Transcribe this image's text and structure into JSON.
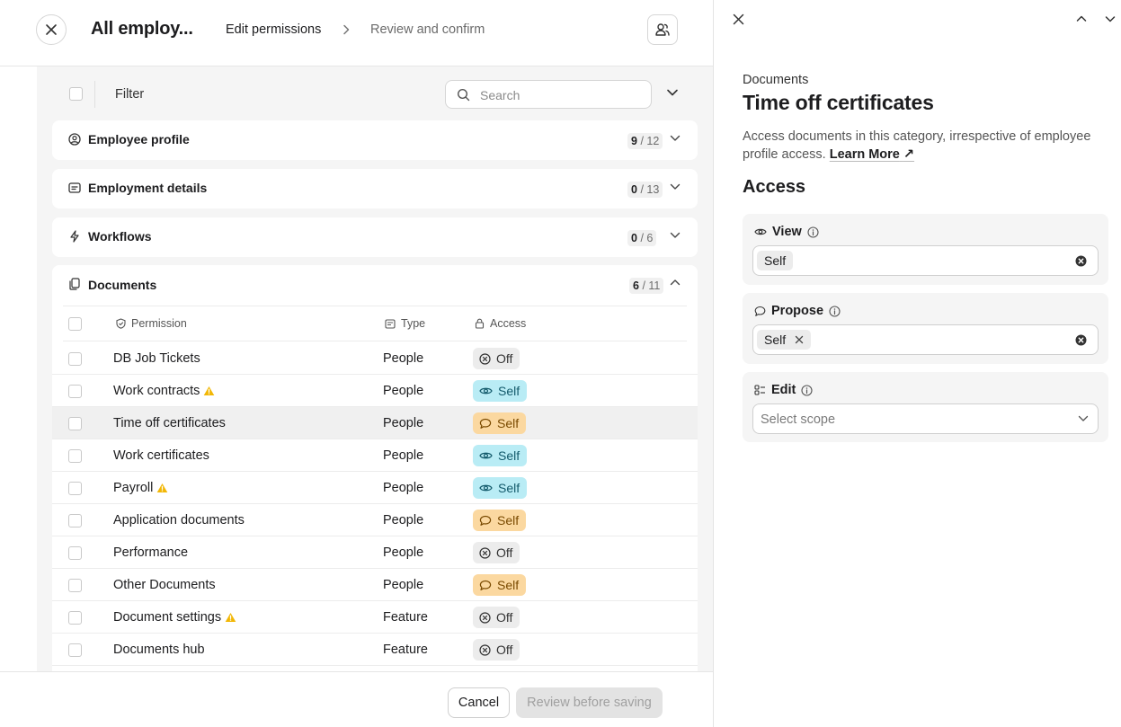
{
  "header": {
    "title": "All employ...",
    "steps": [
      "Edit permissions",
      "Review and confirm"
    ]
  },
  "filterbar": {
    "filter_label": "Filter",
    "search_placeholder": "Search"
  },
  "sections": [
    {
      "title": "Employee profile",
      "count_on": "9",
      "count_total": "/ 12",
      "icon": "user-circle-icon"
    },
    {
      "title": "Employment details",
      "count_on": "0",
      "count_total": "/ 13",
      "icon": "id-card-icon"
    },
    {
      "title": "Workflows",
      "count_on": "0",
      "count_total": "/ 6",
      "icon": "lightning-icon"
    }
  ],
  "documents": {
    "title": "Documents",
    "count_on": "6",
    "count_total": "/ 11",
    "columns": {
      "permission": "Permission",
      "type": "Type",
      "access": "Access"
    },
    "rows": [
      {
        "name": "DB Job Tickets",
        "type": "People",
        "access": "Off",
        "kind": "off",
        "warning": false
      },
      {
        "name": "Work contracts",
        "type": "People",
        "access": "Self",
        "kind": "view",
        "warning": true
      },
      {
        "name": "Time off certificates",
        "type": "People",
        "access": "Self",
        "kind": "propose",
        "warning": false
      },
      {
        "name": "Work certificates",
        "type": "People",
        "access": "Self",
        "kind": "view",
        "warning": false
      },
      {
        "name": "Payroll",
        "type": "People",
        "access": "Self",
        "kind": "view",
        "warning": true
      },
      {
        "name": "Application documents",
        "type": "People",
        "access": "Self",
        "kind": "propose",
        "warning": false
      },
      {
        "name": "Performance",
        "type": "People",
        "access": "Off",
        "kind": "off",
        "warning": false
      },
      {
        "name": "Other Documents",
        "type": "People",
        "access": "Self",
        "kind": "propose",
        "warning": false
      },
      {
        "name": "Document settings",
        "type": "Feature",
        "access": "Off",
        "kind": "off",
        "warning": true
      },
      {
        "name": "Documents hub",
        "type": "Feature",
        "access": "Off",
        "kind": "off",
        "warning": false
      }
    ]
  },
  "footer": {
    "cancel_label": "Cancel",
    "review_label": "Review before saving"
  },
  "panel": {
    "category": "Documents",
    "title": "Time off certificates",
    "description": "Access documents in this category, irrespective of employee profile access.",
    "learn_more": "Learn More",
    "access_heading": "Access",
    "view": {
      "label": "View",
      "value": "Self"
    },
    "propose": {
      "label": "Propose",
      "value": "Self"
    },
    "edit": {
      "label": "Edit",
      "placeholder": "Select scope"
    }
  },
  "colors": {
    "view_pill": "#b9ecf5",
    "propose_pill": "#fbd8a0",
    "off_pill": "#ececec",
    "warning": "#f2b705"
  }
}
